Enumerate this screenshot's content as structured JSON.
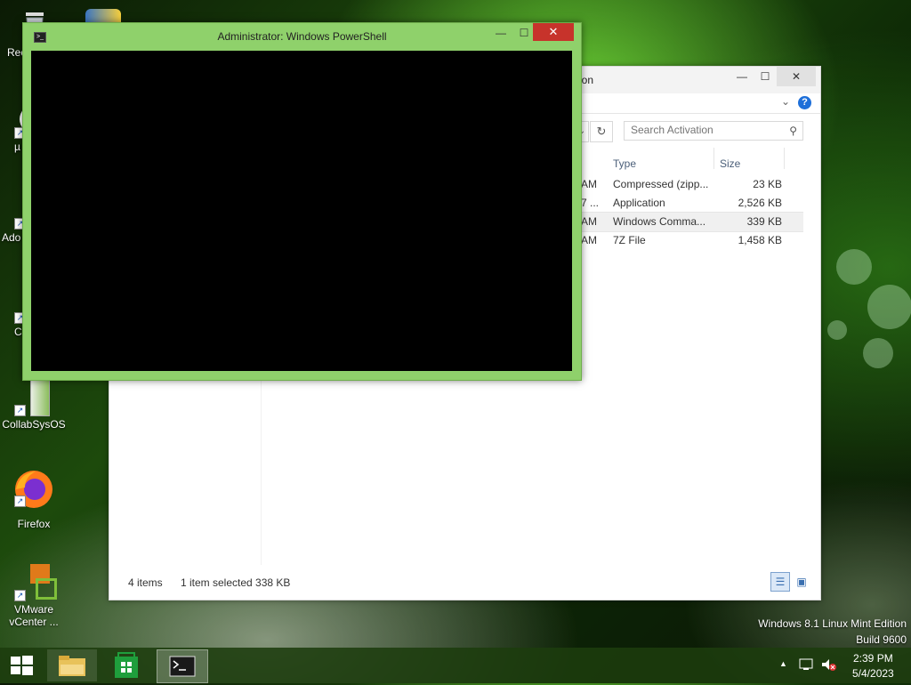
{
  "desktop": {
    "icons": [
      {
        "label": "Rec",
        "icon": "recycle-bin-icon"
      },
      {
        "label": "µ",
        "icon": "utorrent-icon"
      },
      {
        "label": "Ado",
        "icon": "adobe-icon"
      },
      {
        "label": "C",
        "icon": "app-icon"
      },
      {
        "label": "CollabSysOS",
        "icon": "collabsysos-icon"
      },
      {
        "label": "Firefox",
        "icon": "firefox-icon"
      },
      {
        "label": "VMware vCenter ...",
        "icon": "vmware-icon"
      }
    ]
  },
  "powershell": {
    "title": "Administrator: Windows PowerShell",
    "minimize": "—",
    "maximize": "☐",
    "close": "✕"
  },
  "explorer": {
    "title_fragment": "ion",
    "minimize": "—",
    "maximize": "☐",
    "close": "✕",
    "help": "?",
    "search_placeholder": "Search Activation",
    "columns": {
      "type": "Type",
      "size": "Size"
    },
    "rows": [
      {
        "time": "AM",
        "type": "Compressed (zipp...",
        "size": "23 KB",
        "selected": false
      },
      {
        "time": "7 ...",
        "type": "Application",
        "size": "2,526 KB",
        "selected": false
      },
      {
        "time": "AM",
        "type": "Windows Comma...",
        "size": "339 KB",
        "selected": true
      },
      {
        "time": "AM",
        "type": "7Z File",
        "size": "1,458 KB",
        "selected": false
      }
    ],
    "status": {
      "items": "4 items",
      "selection": "1 item selected  338 KB"
    }
  },
  "watermark": {
    "line1": "Windows 8.1 Linux Mint Edition",
    "line2": "Build 9600"
  },
  "taskbar": {
    "apps": [
      {
        "name": "file-explorer",
        "icon": "folder-icon"
      },
      {
        "name": "store",
        "icon": "store-icon"
      },
      {
        "name": "powershell",
        "icon": "terminal-icon",
        "active": true
      }
    ],
    "clock": {
      "time": "2:39 PM",
      "date": "5/4/2023"
    }
  },
  "colors": {
    "ps_frame": "#8fd16b",
    "close_red": "#c7332b",
    "accent_blue": "#1e6fd9"
  }
}
